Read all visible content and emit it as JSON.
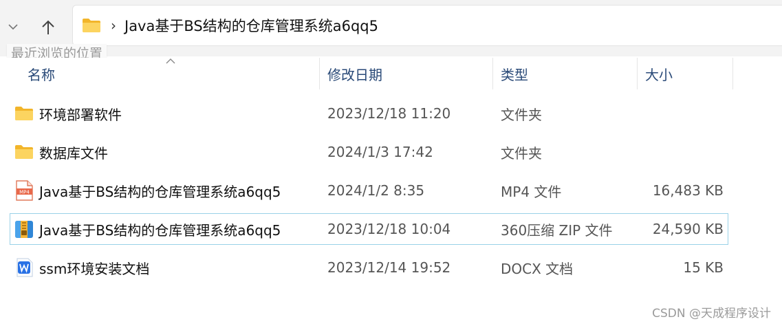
{
  "toolbar": {
    "address_path": "Java基于BS结构的仓库管理系统a6qq5",
    "tooltip": "最近浏览的位置"
  },
  "columns": {
    "name": "名称",
    "date": "修改日期",
    "type": "类型",
    "size": "大小"
  },
  "files": [
    {
      "icon": "folder-icon",
      "name": "环境部署软件",
      "date": "2023/12/18 11:20",
      "type": "文件夹",
      "size": ""
    },
    {
      "icon": "folder-icon",
      "name": "数据库文件",
      "date": "2024/1/3 17:42",
      "type": "文件夹",
      "size": ""
    },
    {
      "icon": "mp4-file-icon",
      "name": "Java基于BS结构的仓库管理系统a6qq5",
      "date": "2024/1/2 8:35",
      "type": "MP4 文件",
      "size": "16,483 KB"
    },
    {
      "icon": "zip-archive-icon",
      "name": "Java基于BS结构的仓库管理系统a6qq5",
      "date": "2023/12/18 10:04",
      "type": "360压缩 ZIP 文件",
      "size": "24,590 KB"
    },
    {
      "icon": "word-doc-icon",
      "name": "ssm环境安装文档",
      "date": "2023/12/14 19:52",
      "type": "DOCX 文档",
      "size": "15 KB"
    }
  ],
  "selected_row": 3,
  "watermark": "CSDN @天成程序设计",
  "colors": {
    "folder": "#f7c948",
    "selection_border": "#99d1e8",
    "header_text": "#2a4a78"
  }
}
